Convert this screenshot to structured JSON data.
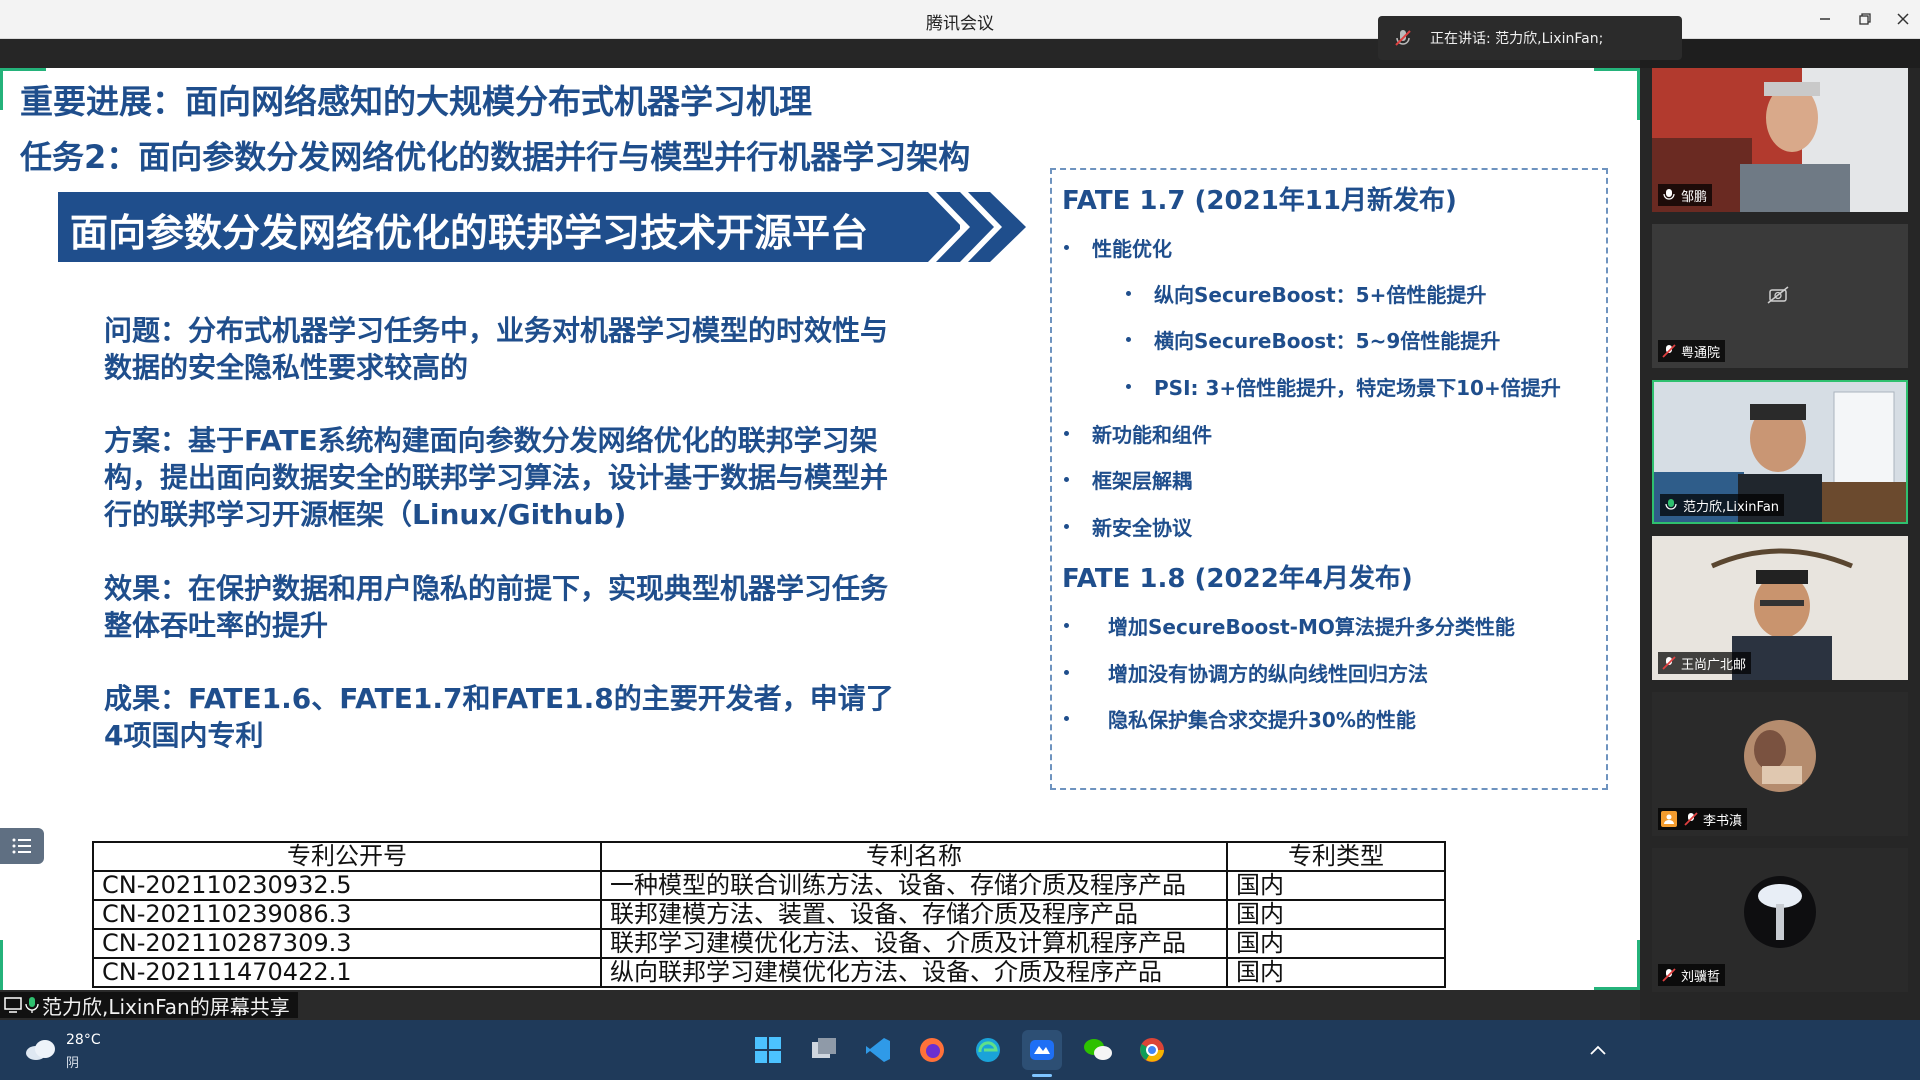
{
  "window": {
    "title": "腾讯会议"
  },
  "speaking": {
    "text": "正在讲话: 范力欣,LixinFan;"
  },
  "slide": {
    "title1": "重要进展：面向网络感知的大规模分布式机器学习机理",
    "title2": "任务2：面向参数分发网络优化的数据并行与模型并行机器学习架构",
    "banner": "面向参数分发网络优化的联邦学习技术开源平台",
    "problem": "问题：分布式机器学习任务中，业务对机器学习模型的时效性与数据的安全隐私性要求较高的",
    "solution": "方案：基于FATE系统构建面向参数分发网络优化的联邦学习架构，提出面向数据安全的联邦学习算法，设计基于数据与模型并行的联邦学习开源框架（Linux/Github)",
    "effect": "效果：在保护数据和用户隐私的前提下，实现典型机器学习任务整体吞吐率的提升",
    "outcome": "成果：FATE1.6、FATE1.7和FATE1.8的主要开发者，申请了4项国内专利",
    "fate17": {
      "heading": "FATE 1.7 (2021年11月新发布)",
      "items": [
        {
          "text": "性能优化",
          "sub": [
            "纵向SecureBoost：5+倍性能提升",
            "横向SecureBoost：5~9倍性能提升",
            "PSI: 3+倍性能提升，特定场景下10+倍提升"
          ]
        },
        {
          "text": "新功能和组件"
        },
        {
          "text": "框架层解耦"
        },
        {
          "text": "新安全协议"
        }
      ]
    },
    "fate18": {
      "heading": "FATE 1.8 (2022年4月发布)",
      "items": [
        "增加SecureBoost-MO算法提升多分类性能",
        "增加没有协调方的纵向线性回归方法",
        "隐私保护集合求交提升30%的性能"
      ]
    },
    "patents": {
      "headers": [
        "专利公开号",
        "专利名称",
        "专利类型"
      ],
      "rows": [
        [
          "CN-202110230932.5",
          "一种模型的联合训练方法、设备、存储介质及程序产品",
          "国内"
        ],
        [
          "CN-202110239086.3",
          "联邦建模方法、装置、设备、存储介质及程序产品",
          "国内"
        ],
        [
          "CN-202110287309.3",
          "联邦学习建模优化方法、设备、介质及计算机程序产品",
          "国内"
        ],
        [
          "CN-202111470422.1",
          "纵向联邦学习建模优化方法、设备、介质及程序产品",
          "国内"
        ]
      ]
    }
  },
  "share_label": "范力欣,LixinFan的屏幕共享",
  "participants": [
    {
      "name": "邹鹏",
      "mic": "on",
      "video": "person-older"
    },
    {
      "name": "粤通院",
      "mic": "muted",
      "video": "off"
    },
    {
      "name": "范力欣,LixinFan",
      "mic": "on",
      "video": "person-speaker",
      "active": true
    },
    {
      "name": "王尚广北邮",
      "mic": "muted",
      "video": "person-glasses"
    },
    {
      "name": "李书滇",
      "mic": "muted",
      "video": "avatar-photo"
    },
    {
      "name": "刘骥哲",
      "mic": "muted",
      "video": "avatar-dark"
    }
  ],
  "weather": {
    "temp": "28°C",
    "desc": "阴"
  },
  "colors": {
    "accent": "#1f4e8c",
    "green": "#24b27a",
    "taskbar": "#1f3a5a"
  }
}
